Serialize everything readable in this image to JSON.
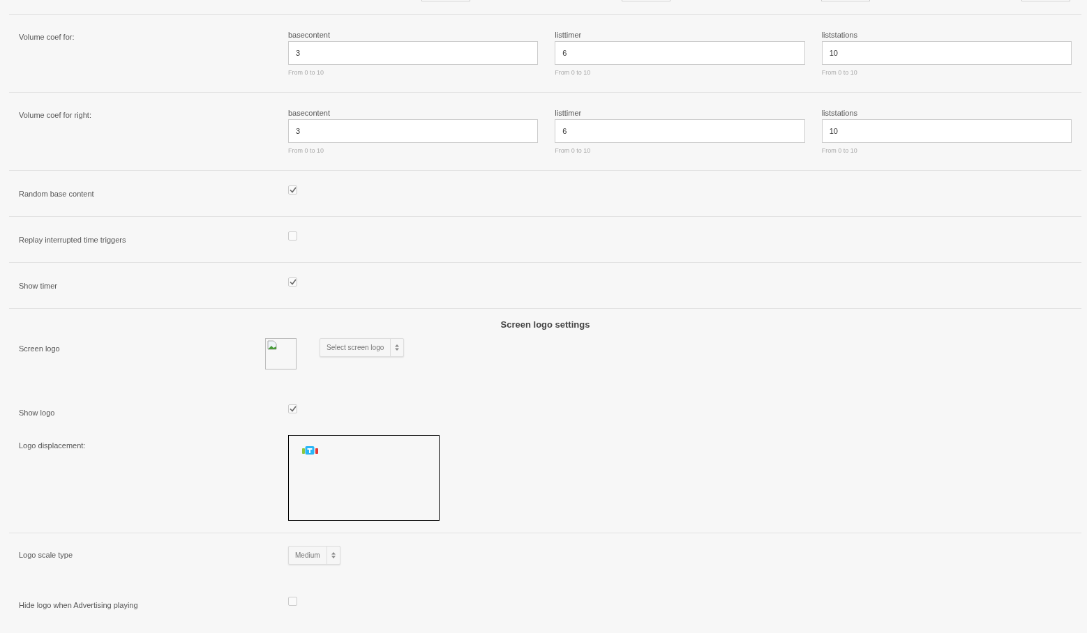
{
  "sections": [
    {
      "rows": [
        {
          "kind": "coef",
          "label": "Volume coef for:",
          "fields": [
            {
              "label": "basecontent",
              "value": "3",
              "hint": "From 0 to 10"
            },
            {
              "label": "listtimer",
              "value": "6",
              "hint": "From 0 to 10"
            },
            {
              "label": "liststations",
              "value": "10",
              "hint": "From 0 to 10"
            }
          ]
        }
      ]
    },
    {
      "rows": [
        {
          "kind": "coef",
          "label": "Volume coef for right:",
          "fields": [
            {
              "label": "basecontent",
              "value": "3",
              "hint": "From 0 to 10"
            },
            {
              "label": "listtimer",
              "value": "6",
              "hint": "From 0 to 10"
            },
            {
              "label": "liststations",
              "value": "10",
              "hint": "From 0 to 10"
            }
          ]
        }
      ]
    },
    {
      "rows": [
        {
          "kind": "checkbox",
          "label": "Random base content",
          "checked": true
        }
      ]
    },
    {
      "rows": [
        {
          "kind": "checkbox",
          "label": "Replay interrupted time triggers",
          "checked": false
        }
      ]
    },
    {
      "rows": [
        {
          "kind": "checkbox",
          "label": "Show timer",
          "checked": true
        }
      ]
    },
    {
      "rows": [
        {
          "kind": "heading",
          "label": "Screen logo settings"
        },
        {
          "kind": "logo_picker",
          "label": "Screen logo",
          "button": "Select screen logo"
        },
        {
          "kind": "checkbox",
          "label": "Show logo",
          "checked": true
        },
        {
          "kind": "displacement",
          "label": "Logo displacement:"
        }
      ]
    },
    {
      "rows": [
        {
          "kind": "select",
          "label": "Logo scale type",
          "value": "Medium"
        },
        {
          "kind": "checkbox",
          "label": "Hide logo when Advertising playing",
          "checked": false
        }
      ]
    }
  ]
}
